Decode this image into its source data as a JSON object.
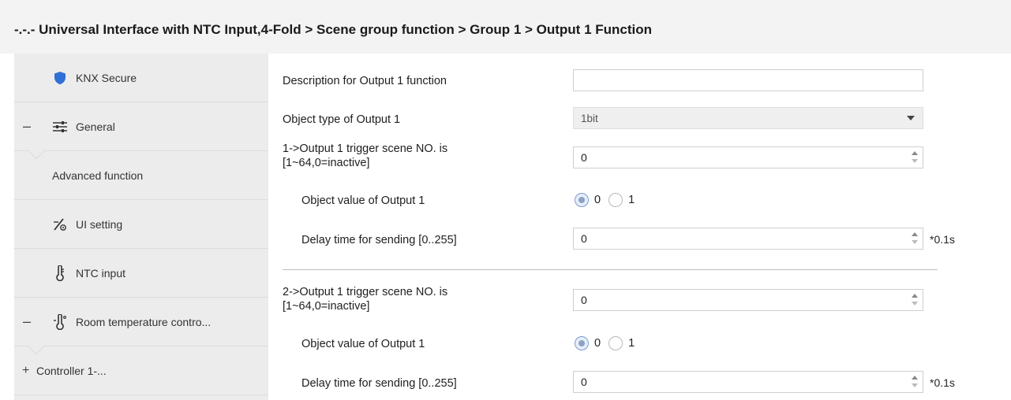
{
  "header": {
    "title": "-.-.- Universal Interface with NTC Input,4-Fold > Scene group function > Group 1 > Output 1 Function"
  },
  "sidebar": {
    "items": [
      {
        "label": "KNX Secure",
        "icon": "shield-icon"
      },
      {
        "label": "General",
        "icon": "sliders-icon",
        "toggle": "–"
      },
      {
        "label": "Advanced function"
      },
      {
        "label": "UI setting",
        "icon": "ui-setting-icon"
      },
      {
        "label": "NTC input",
        "icon": "thermometer-icon"
      },
      {
        "label": "Room temperature contro...",
        "icon": "room-thermometer-icon",
        "toggle": "–"
      },
      {
        "label": "Controller 1-...",
        "toggle": "+"
      }
    ]
  },
  "form": {
    "description": {
      "label": "Description for Output 1 function",
      "value": ""
    },
    "object_type": {
      "label": "Object type of Output 1",
      "value": "1bit"
    },
    "scene1": {
      "trigger_label_line1": "1->Output 1 trigger scene NO. is",
      "trigger_label_line2": "[1~64,0=inactive]",
      "trigger_value": "0",
      "object_value_label": "Object value of Output 1",
      "radio_options": [
        "0",
        "1"
      ],
      "selected": "0",
      "delay_label": "Delay time for sending [0..255]",
      "delay_value": "0",
      "delay_unit": "*0.1s"
    },
    "scene2": {
      "trigger_label_line1": "2->Output 1 trigger scene NO. is",
      "trigger_label_line2": "[1~64,0=inactive]",
      "trigger_value": "0",
      "object_value_label": "Object value of Output 1",
      "radio_options": [
        "0",
        "1"
      ],
      "selected": "0",
      "delay_label": "Delay time for sending [0..255]",
      "delay_value": "0",
      "delay_unit": "*0.1s"
    }
  },
  "colors": {
    "accent_blue": "#2f6fd6",
    "sidebar_bg": "#ececec",
    "titlebar_bg": "#f3f3f3"
  }
}
